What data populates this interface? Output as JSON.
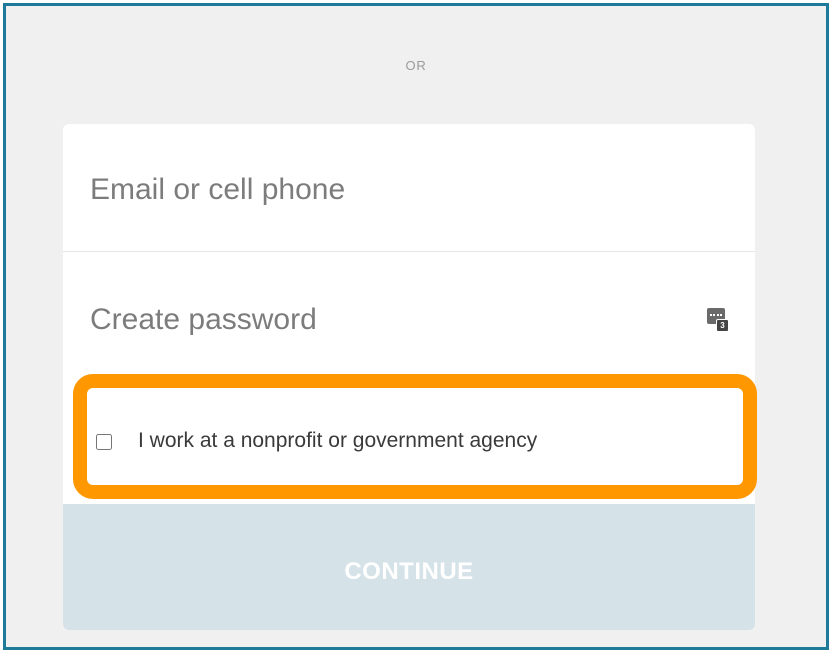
{
  "divider": {
    "label": "OR"
  },
  "form": {
    "email_placeholder": "Email or cell phone",
    "password_placeholder": "Create password",
    "password_icon_badge": "3",
    "nonprofit_label": "I work at a nonprofit or government agency",
    "nonprofit_checked": false,
    "continue_label": "CONTINUE"
  },
  "colors": {
    "frame_border": "#1f7a9a",
    "highlight": "#ff9800",
    "continue_bg": "#d5e2e8"
  },
  "icons": {
    "password_field_icon": "password-manager-icon"
  }
}
